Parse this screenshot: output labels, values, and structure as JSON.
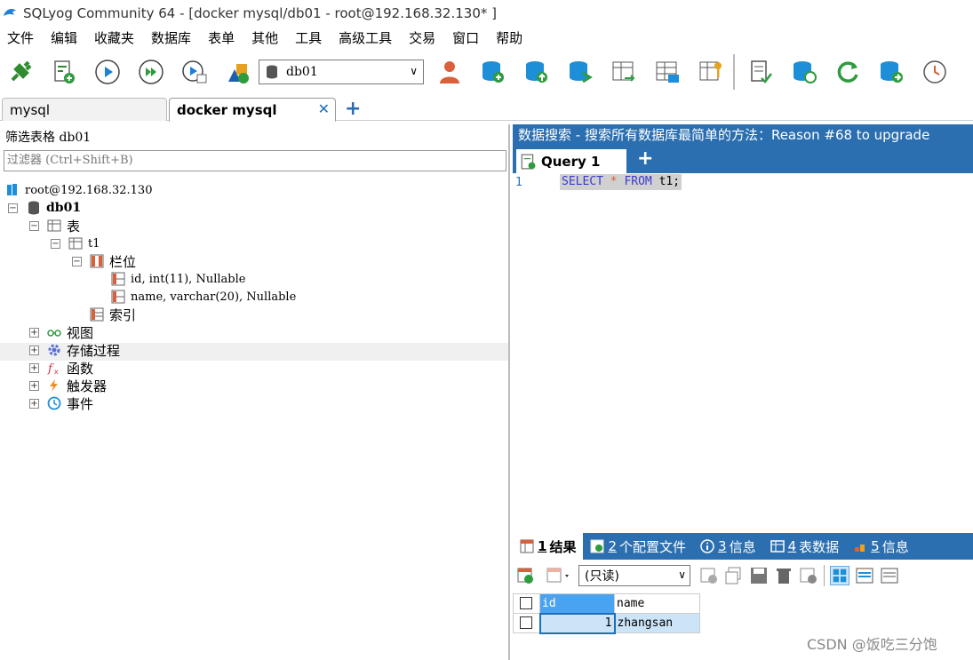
{
  "window": {
    "title": "SQLyog Community 64 - [docker mysql/db01 - root@192.168.32.130* ]"
  },
  "menu": [
    "文件",
    "编辑",
    "收藏夹",
    "数据库",
    "表单",
    "其他",
    "工具",
    "高级工具",
    "交易",
    "窗口",
    "帮助"
  ],
  "toolbar": {
    "db_selected": "db01"
  },
  "tabs": {
    "tab1": "mysql",
    "tab2": "docker mysql"
  },
  "left": {
    "filter_label": "筛选表格",
    "filter_db": "db01",
    "filter_placeholder": "过滤器 (Ctrl+Shift+B)",
    "tree": {
      "root": "root@192.168.32.130",
      "db": "db01",
      "tables": "表",
      "t1": "t1",
      "columns": "栏位",
      "col1": "id, int(11), Nullable",
      "col2": "name, varchar(20), Nullable",
      "indexes": "索引",
      "views": "视图",
      "procs": "存储过程",
      "funcs": "函数",
      "triggers": "触发器",
      "events": "事件"
    }
  },
  "right": {
    "header": "数据搜索 - 搜索所有数据库最简单的方法：Reason #68 to upgrade",
    "query_tab": "Query 1",
    "line_no": "1",
    "sql": {
      "kw1": "SELECT",
      "star": "*",
      "kw2": "FROM",
      "rest": "t1;"
    }
  },
  "bottom": {
    "tabs": [
      {
        "num": "1",
        "label": "结果"
      },
      {
        "num": "2",
        "label": "个配置文件"
      },
      {
        "num": "3",
        "label": "信息"
      },
      {
        "num": "4",
        "label": "表数据"
      },
      {
        "num": "5",
        "label": "信息"
      }
    ],
    "mode": "(只读)",
    "columns": [
      "id",
      "name"
    ],
    "rows": [
      {
        "id": "1",
        "name": "zhangsan"
      }
    ]
  },
  "watermark": "CSDN @饭吃三分饱"
}
